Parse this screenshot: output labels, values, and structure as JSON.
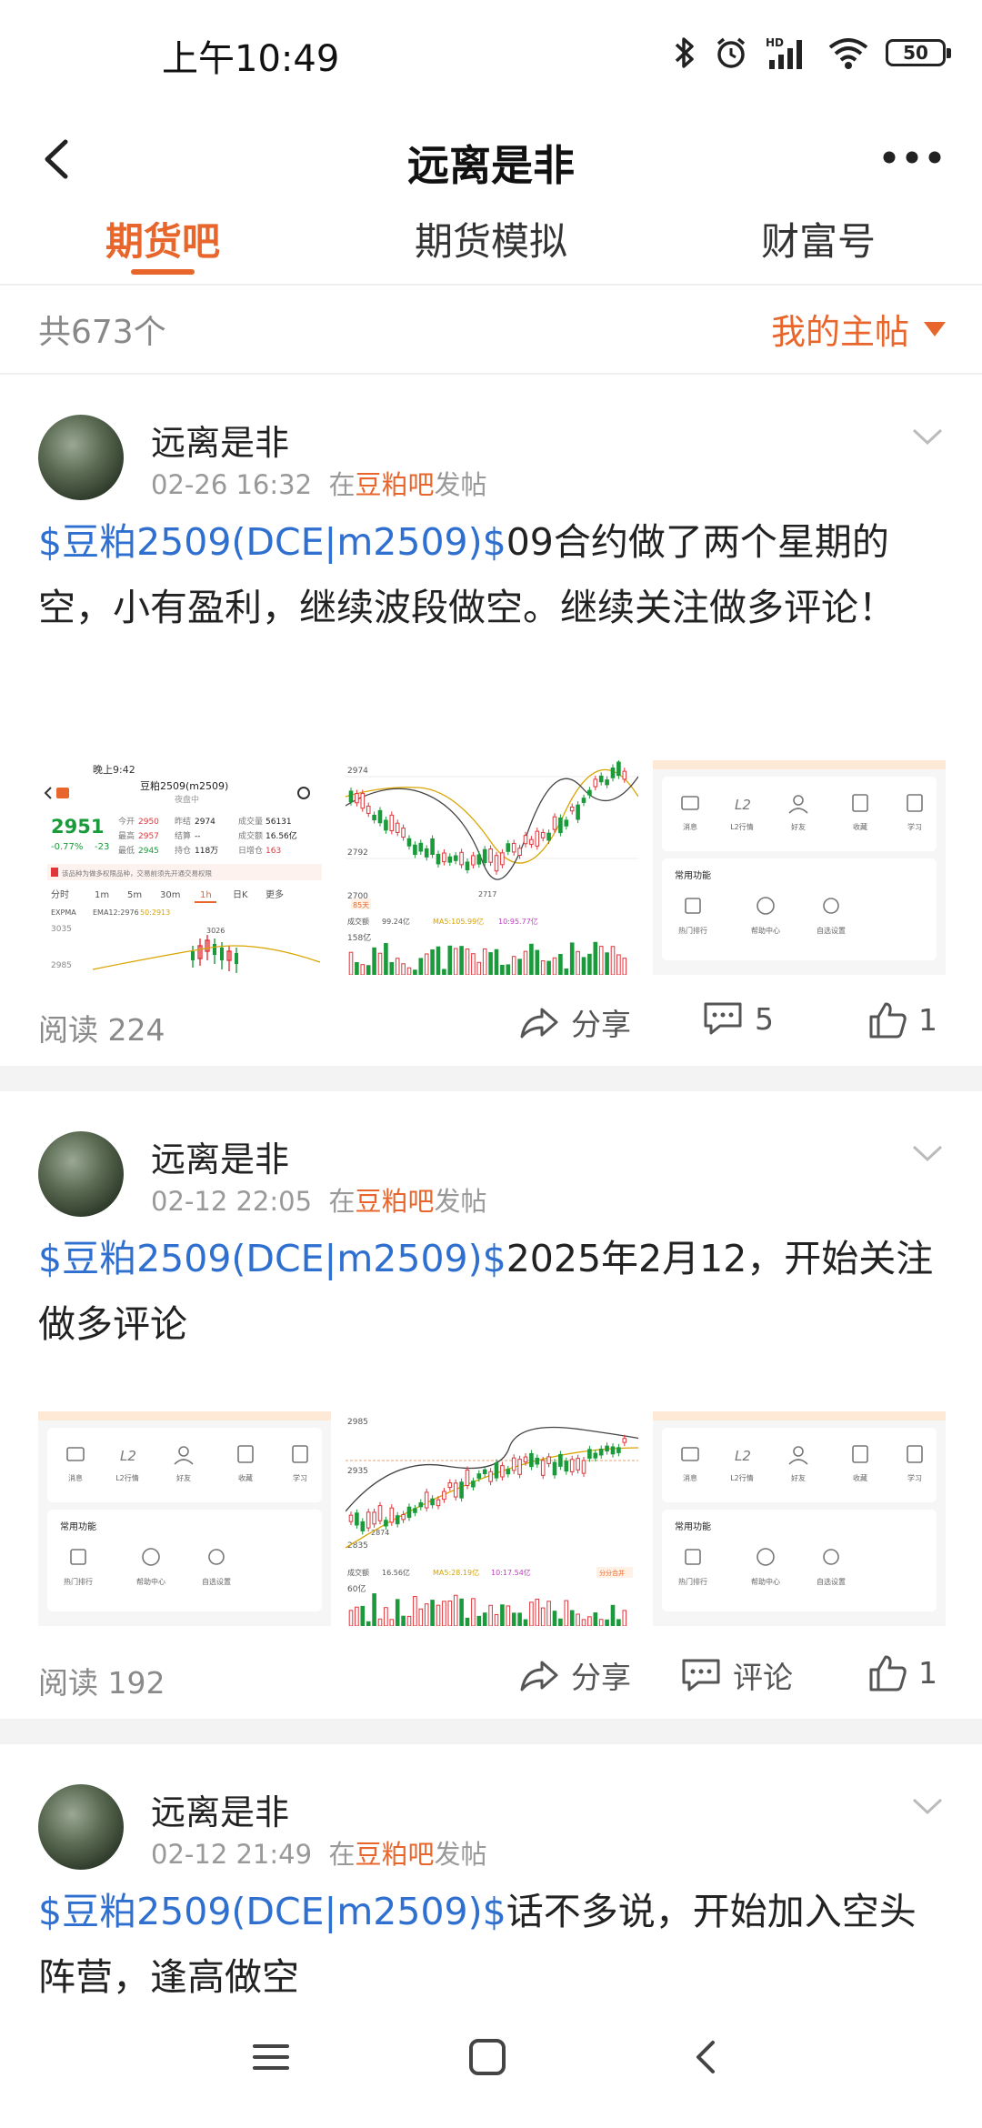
{
  "status": {
    "time": "上午10:49",
    "battery": "50"
  },
  "nav": {
    "title": "远离是非"
  },
  "tabs": [
    {
      "label": "期货吧",
      "active": true
    },
    {
      "label": "期货模拟",
      "active": false
    },
    {
      "label": "财富号",
      "active": false
    }
  ],
  "subheader": {
    "count": "共673个",
    "filter": "我的主帖"
  },
  "posts": [
    {
      "author": "远离是非",
      "time": "02-26 16:32",
      "in": "在",
      "bar": "豆粕吧",
      "posted": "发帖",
      "stock": "$豆粕2509(DCE|m2509)$",
      "text": "09合约做了两个星期的空，小有盈利，继续波段做空。继续关注做多评论！",
      "reads": "阅读 224",
      "share": "分享",
      "comments": "5",
      "likes": "1",
      "thumb1": {
        "time": "晚上9:42",
        "name": "豆粕2509(m2509)",
        "status": "夜盘中",
        "price": "2951",
        "change": "-0.77%",
        "change_abs": "-23",
        "fields": [
          [
            "今开",
            "2950"
          ],
          [
            "昨结",
            "2974"
          ],
          [
            "成交量",
            "56131"
          ],
          [
            "最高",
            "2957"
          ],
          [
            "结算",
            "--"
          ],
          [
            "成交额",
            "16.56亿"
          ],
          [
            "最低",
            "2945"
          ],
          [
            "持仓",
            "118万"
          ],
          [
            "日增仓",
            "163"
          ]
        ],
        "notice": "该品种为做多权限品种，交易前须先开通交易权限",
        "periods": [
          "分时",
          "1m",
          "5m",
          "30m",
          "1h",
          "日K",
          "更多"
        ],
        "indicator": "EXPMA",
        "ema": "EMA12:2976",
        "ema2": "50:2913",
        "y_top": "3035",
        "y_low": "2985",
        "peak": "3026"
      },
      "thumb2": {
        "y_top": "2974",
        "y_mid": "2792",
        "y_low": "2700",
        "low_mark": "2717",
        "days": "85天",
        "vol_label": "成交额",
        "vol_val": "99.24亿",
        "ma5": "MA5:105.99亿",
        "ma10": "10:95.77亿",
        "vol_axis": "158亿"
      },
      "thumb3": {
        "icons": [
          "消息",
          "L2行情",
          "好友",
          "收藏",
          "学习"
        ],
        "section": "常用功能",
        "funcs": [
          "热门排行",
          "帮助中心",
          "自选设置"
        ]
      }
    },
    {
      "author": "远离是非",
      "time": "02-12 22:05",
      "in": "在",
      "bar": "豆粕吧",
      "posted": "发帖",
      "stock": "$豆粕2509(DCE|m2509)$",
      "text": "2025年2月12，开始关注做多评论",
      "reads": "阅读 192",
      "share": "分享",
      "comments": "评论",
      "likes": "1",
      "thumb1": {
        "icons": [
          "消息",
          "L2行情",
          "好友",
          "收藏",
          "学习"
        ],
        "section": "常用功能",
        "funcs": [
          "热门排行",
          "帮助中心",
          "自选设置"
        ]
      },
      "thumb2": {
        "y_top": "2985",
        "y_mid": "2935",
        "y_low": "2835",
        "low_mark": "2874",
        "vol_label": "成交额",
        "vol_val": "16.56亿",
        "ma5": "MA5:28.19亿",
        "ma10": "10:17.54亿",
        "badge": "分分合并",
        "vol_axis": "60亿"
      },
      "thumb3": {
        "icons": [
          "消息",
          "L2行情",
          "好友",
          "收藏",
          "学习"
        ],
        "section": "常用功能",
        "funcs": [
          "热门排行",
          "帮助中心",
          "自选设置"
        ]
      }
    },
    {
      "author": "远离是非",
      "time": "02-12 21:49",
      "in": "在",
      "bar": "豆粕吧",
      "posted": "发帖",
      "stock": "$豆粕2509(DCE|m2509)$",
      "text": "话不多说，开始加入空头阵营，逢高做空"
    }
  ],
  "colors": {
    "accent": "#e8662c",
    "link": "#2e6fd0",
    "up": "#e0363b",
    "down": "#1a9a3a"
  }
}
